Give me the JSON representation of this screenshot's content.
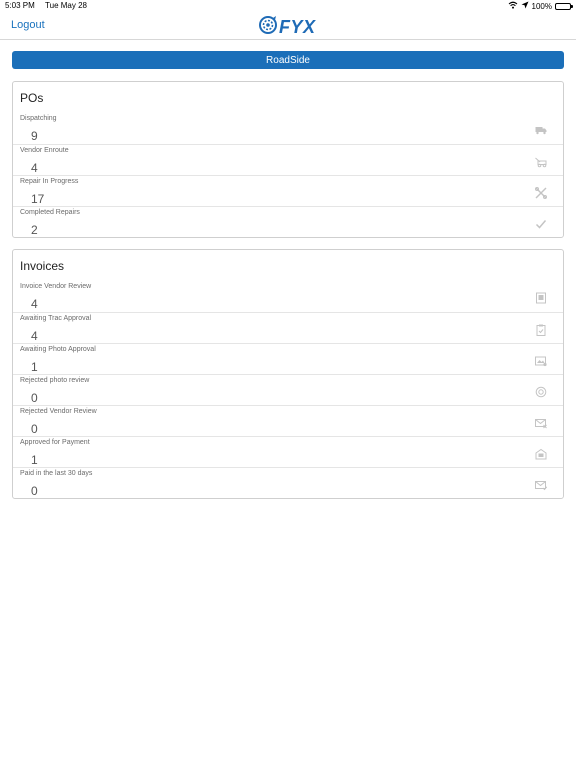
{
  "status_bar": {
    "time": "5:03 PM",
    "date": "Tue May 28",
    "battery": "100%"
  },
  "nav": {
    "logout_label": "Logout",
    "logo_text": "FYX"
  },
  "roadside_label": "RoadSide",
  "pos": {
    "title": "POs",
    "rows": [
      {
        "label": "Dispatching",
        "value": "9",
        "icon": "truck-icon"
      },
      {
        "label": "Vendor Enroute",
        "value": "4",
        "icon": "tow-truck-icon"
      },
      {
        "label": "Repair In Progress",
        "value": "17",
        "icon": "tools-icon"
      },
      {
        "label": "Completed Repairs",
        "value": "2",
        "icon": "checkmark-icon"
      }
    ]
  },
  "invoices": {
    "title": "Invoices",
    "rows": [
      {
        "label": "Invoice Vendor Review",
        "value": "4",
        "icon": "invoice-icon"
      },
      {
        "label": "Awaiting Trac Approval",
        "value": "4",
        "icon": "clipboard-icon"
      },
      {
        "label": "Awaiting Photo Approval",
        "value": "1",
        "icon": "photo-icon"
      },
      {
        "label": "Rejected photo review",
        "value": "0",
        "icon": "rejected-icon"
      },
      {
        "label": "Rejected Vendor Review",
        "value": "0",
        "icon": "rejected-mail-icon"
      },
      {
        "label": "Approved for Payment",
        "value": "1",
        "icon": "approved-icon"
      },
      {
        "label": "Paid in the last 30 days",
        "value": "0",
        "icon": "paid-icon"
      }
    ]
  },
  "colors": {
    "accent": "#1b6fb9",
    "icon_gray": "#c4c4c4"
  }
}
